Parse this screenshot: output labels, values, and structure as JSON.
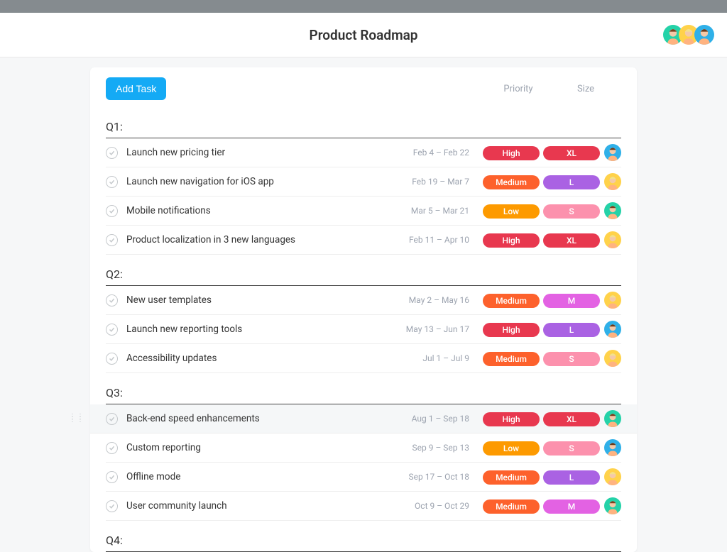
{
  "header": {
    "title": "Product Roadmap",
    "avatars": [
      {
        "bg": "#24d2a8",
        "hair": "#7b3f1e"
      },
      {
        "bg": "#ffd24a",
        "hair": "#f3e28b"
      },
      {
        "bg": "#2fb0e8",
        "hair": "#6b3a1a"
      }
    ]
  },
  "toolbar": {
    "add_label": "Add Task",
    "columns": {
      "priority": "Priority",
      "size": "Size"
    }
  },
  "colors": {
    "priority": {
      "High": "#e8384f",
      "Medium": "#fd612c",
      "Low": "#fd9a00"
    },
    "size": {
      "XL": "#e8384f",
      "L": "#aa62e3",
      "M": "#e362e3",
      "S": "#fc91ad"
    }
  },
  "sections": [
    {
      "title": "Q1:",
      "tasks": [
        {
          "name": "Launch new pricing tier",
          "dates": "Feb 4 – Feb 22",
          "priority": "High",
          "size": "XL",
          "avatar": {
            "bg": "#2fb0e8",
            "hair": "#6b3a1a"
          }
        },
        {
          "name": "Launch new navigation for iOS app",
          "dates": "Feb 19 – Mar 7",
          "priority": "Medium",
          "size": "L",
          "avatar": {
            "bg": "#ffd24a",
            "hair": "#f3e28b"
          }
        },
        {
          "name": "Mobile notifications",
          "dates": "Mar 5 – Mar 21",
          "priority": "Low",
          "size": "S",
          "avatar": {
            "bg": "#24d2a8",
            "hair": "#7b3f1e"
          }
        },
        {
          "name": "Product localization in 3 new languages",
          "dates": "Feb 11 – Apr 10",
          "priority": "High",
          "size": "XL",
          "avatar": {
            "bg": "#ffd24a",
            "hair": "#f3e28b"
          }
        }
      ]
    },
    {
      "title": "Q2:",
      "tasks": [
        {
          "name": "New user templates",
          "dates": "May 2 – May 16",
          "priority": "Medium",
          "size": "M",
          "avatar": {
            "bg": "#ffd24a",
            "hair": "#f3e28b"
          }
        },
        {
          "name": "Launch new reporting tools",
          "dates": "May 13 – Jun 17",
          "priority": "High",
          "size": "L",
          "avatar": {
            "bg": "#2fb0e8",
            "hair": "#6b3a1a"
          }
        },
        {
          "name": "Accessibility updates",
          "dates": "Jul 1 – Jul 9",
          "priority": "Medium",
          "size": "S",
          "avatar": {
            "bg": "#ffd24a",
            "hair": "#f3e28b"
          }
        }
      ]
    },
    {
      "title": "Q3:",
      "tasks": [
        {
          "name": "Back-end speed enhancements",
          "dates": "Aug 1 – Sep 18",
          "priority": "High",
          "size": "XL",
          "highlight": true,
          "drag": true,
          "avatar": {
            "bg": "#24d2a8",
            "hair": "#7b3f1e"
          }
        },
        {
          "name": "Custom reporting",
          "dates": "Sep 9 – Sep 13",
          "priority": "Low",
          "size": "S",
          "avatar": {
            "bg": "#2fb0e8",
            "hair": "#6b3a1a"
          }
        },
        {
          "name": "Offline mode",
          "dates": "Sep 17 – Oct 18",
          "priority": "Medium",
          "size": "L",
          "avatar": {
            "bg": "#ffd24a",
            "hair": "#f3e28b"
          }
        },
        {
          "name": "User community launch",
          "dates": "Oct 9 – Oct 29",
          "priority": "Medium",
          "size": "M",
          "avatar": {
            "bg": "#24d2a8",
            "hair": "#7b3f1e"
          }
        }
      ]
    },
    {
      "title": "Q4:",
      "tasks": []
    }
  ]
}
